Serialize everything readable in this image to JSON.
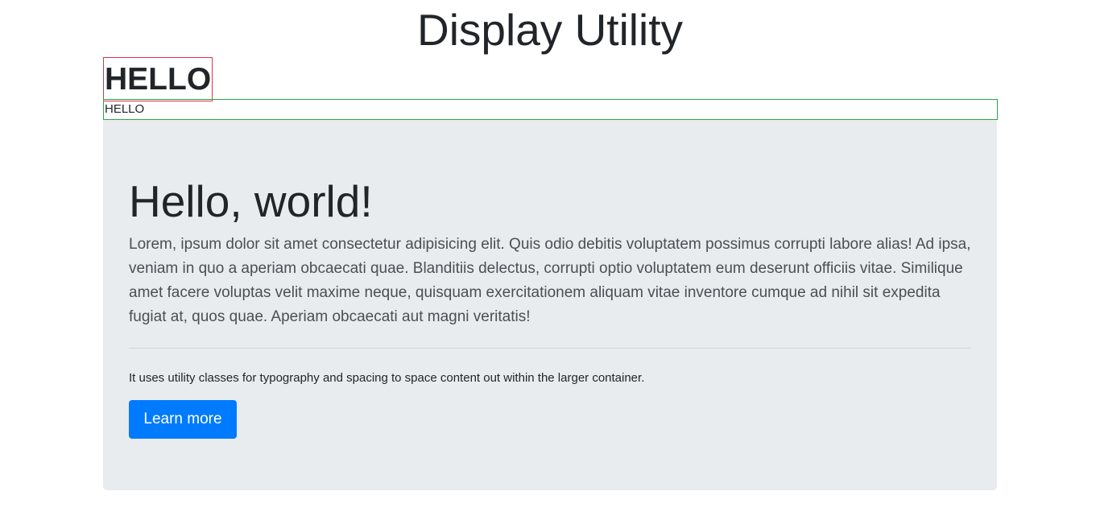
{
  "page": {
    "title": "Display Utility"
  },
  "demo": {
    "inline_text": "HELLO",
    "block_text": "HELLO"
  },
  "jumbotron": {
    "heading": "Hello, world!",
    "lead": "Lorem, ipsum dolor sit amet consectetur adipisicing elit. Quis odio debitis voluptatem possimus corrupti labore alias! Ad ipsa, veniam in quo a aperiam obcaecati quae. Blanditiis delectus, corrupti optio voluptatem eum deserunt officiis vitae. Similique amet facere voluptas velit maxime neque, quisquam exercitationem aliquam vitae inventore cumque ad nihil sit expedita fugiat at, quos quae. Aperiam obcaecati aut magni veritatis!",
    "note": "It uses utility classes for typography and spacing to space content out within the larger container.",
    "button_label": "Learn more"
  },
  "colors": {
    "inline_border": "#dc3545",
    "block_border": "#28a745",
    "jumbotron_bg": "#e9ecef",
    "primary": "#007bff"
  }
}
